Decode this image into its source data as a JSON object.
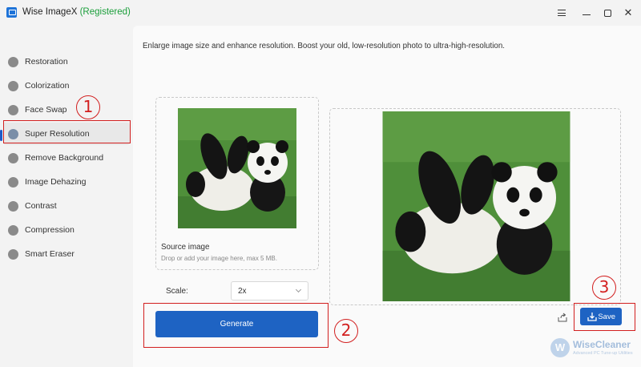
{
  "window": {
    "app_name": "Wise ImageX",
    "registered": "(Registered)"
  },
  "sidebar": {
    "items": [
      {
        "label": "Restoration",
        "icon": "restoration-icon"
      },
      {
        "label": "Colorization",
        "icon": "colorization-icon"
      },
      {
        "label": "Face Swap",
        "icon": "face-swap-icon"
      },
      {
        "label": "Super Resolution",
        "icon": "super-resolution-icon",
        "active": true
      },
      {
        "label": "Remove Background",
        "icon": "remove-background-icon"
      },
      {
        "label": "Image Dehazing",
        "icon": "dehazing-icon"
      },
      {
        "label": "Contrast",
        "icon": "contrast-icon"
      },
      {
        "label": "Compression",
        "icon": "compression-icon"
      },
      {
        "label": "Smart Eraser",
        "icon": "eraser-icon"
      }
    ]
  },
  "main": {
    "description": "Enlarge image size and enhance resolution. Boost your old, low-resolution photo to ultra-high-resolution.",
    "source": {
      "title": "Source image",
      "hint": "Drop or add your image here, max 5 MB."
    },
    "scale": {
      "label": "Scale:",
      "value": "2x"
    },
    "generate_label": "Generate",
    "save_label": "Save"
  },
  "annotations": {
    "one": "①",
    "two": "②",
    "three": "③"
  },
  "watermark": {
    "logo": "W",
    "name": "WiseCleaner",
    "tagline": "Advanced PC Tune-up Utilities"
  },
  "colors": {
    "accent": "#1e63c3",
    "annotation": "#d21f1f",
    "registered": "#1a9e3a"
  }
}
